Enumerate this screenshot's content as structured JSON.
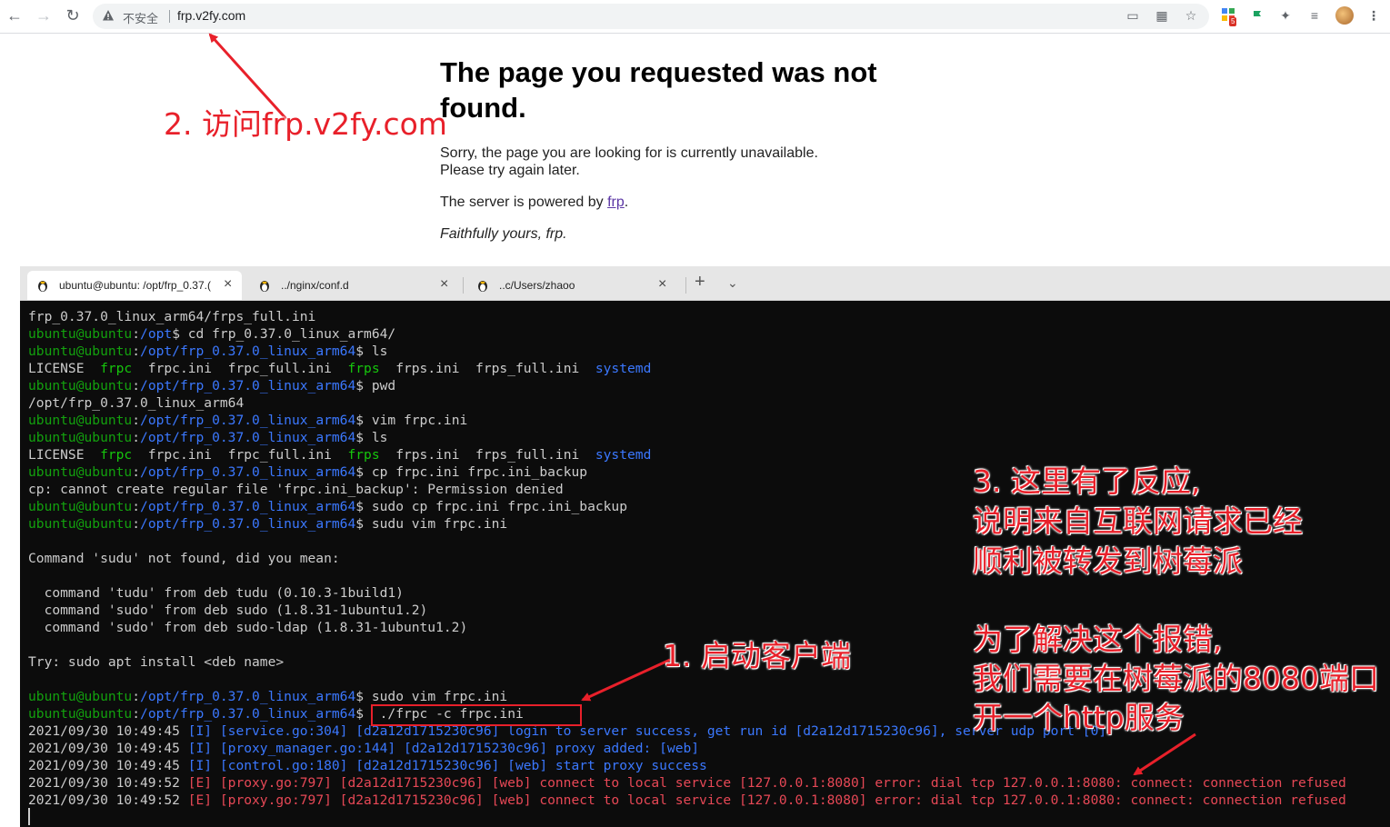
{
  "browser": {
    "security_label": "不安全",
    "url": "frp.v2fy.com",
    "extension_badge": "5"
  },
  "page": {
    "heading": "The page you requested was not found.",
    "sorry_line1": "Sorry, the page you are looking for is currently unavailable.",
    "sorry_line2": "Please try again later.",
    "powered_prefix": "The server is powered by ",
    "powered_link": "frp",
    "powered_suffix": ".",
    "signoff": "Faithfully yours, frp."
  },
  "terminal": {
    "tabs": [
      {
        "label": "ubuntu@ubuntu: /opt/frp_0.37.("
      },
      {
        "label": "../nginx/conf.d"
      },
      {
        "label": "..c/Users/zhaoo"
      }
    ],
    "lines": [
      {
        "segs": [
          {
            "t": "frp_0.37.0_linux_arm64/frps_full.ini",
            "c": ""
          }
        ]
      },
      {
        "segs": [
          {
            "t": "ubuntu@ubuntu",
            "c": "u"
          },
          {
            "t": ":",
            "c": ""
          },
          {
            "t": "/opt",
            "c": "pth"
          },
          {
            "t": "$ cd frp_0.37.0_linux_arm64/",
            "c": ""
          }
        ]
      },
      {
        "segs": [
          {
            "t": "ubuntu@ubuntu",
            "c": "u"
          },
          {
            "t": ":",
            "c": ""
          },
          {
            "t": "/opt/frp_0.37.0_linux_arm64",
            "c": "pth"
          },
          {
            "t": "$ ls",
            "c": ""
          }
        ]
      },
      {
        "segs": [
          {
            "t": "LICENSE  ",
            "c": ""
          },
          {
            "t": "frpc",
            "c": "g"
          },
          {
            "t": "  frpc.ini  frpc_full.ini  ",
            "c": ""
          },
          {
            "t": "frps",
            "c": "g"
          },
          {
            "t": "  frps.ini  frps_full.ini  ",
            "c": ""
          },
          {
            "t": "systemd",
            "c": "bl"
          }
        ]
      },
      {
        "segs": [
          {
            "t": "ubuntu@ubuntu",
            "c": "u"
          },
          {
            "t": ":",
            "c": ""
          },
          {
            "t": "/opt/frp_0.37.0_linux_arm64",
            "c": "pth"
          },
          {
            "t": "$ pwd",
            "c": ""
          }
        ]
      },
      {
        "segs": [
          {
            "t": "/opt/frp_0.37.0_linux_arm64",
            "c": ""
          }
        ]
      },
      {
        "segs": [
          {
            "t": "ubuntu@ubuntu",
            "c": "u"
          },
          {
            "t": ":",
            "c": ""
          },
          {
            "t": "/opt/frp_0.37.0_linux_arm64",
            "c": "pth"
          },
          {
            "t": "$ vim frpc.ini",
            "c": ""
          }
        ]
      },
      {
        "segs": [
          {
            "t": "ubuntu@ubuntu",
            "c": "u"
          },
          {
            "t": ":",
            "c": ""
          },
          {
            "t": "/opt/frp_0.37.0_linux_arm64",
            "c": "pth"
          },
          {
            "t": "$ ls",
            "c": ""
          }
        ]
      },
      {
        "segs": [
          {
            "t": "LICENSE  ",
            "c": ""
          },
          {
            "t": "frpc",
            "c": "g"
          },
          {
            "t": "  frpc.ini  frpc_full.ini  ",
            "c": ""
          },
          {
            "t": "frps",
            "c": "g"
          },
          {
            "t": "  frps.ini  frps_full.ini  ",
            "c": ""
          },
          {
            "t": "systemd",
            "c": "bl"
          }
        ]
      },
      {
        "segs": [
          {
            "t": "ubuntu@ubuntu",
            "c": "u"
          },
          {
            "t": ":",
            "c": ""
          },
          {
            "t": "/opt/frp_0.37.0_linux_arm64",
            "c": "pth"
          },
          {
            "t": "$ cp frpc.ini frpc.ini_backup",
            "c": ""
          }
        ]
      },
      {
        "segs": [
          {
            "t": "cp: cannot create regular file 'frpc.ini_backup': Permission denied",
            "c": ""
          }
        ]
      },
      {
        "segs": [
          {
            "t": "ubuntu@ubuntu",
            "c": "u"
          },
          {
            "t": ":",
            "c": ""
          },
          {
            "t": "/opt/frp_0.37.0_linux_arm64",
            "c": "pth"
          },
          {
            "t": "$ sudo cp frpc.ini frpc.ini_backup",
            "c": ""
          }
        ]
      },
      {
        "segs": [
          {
            "t": "ubuntu@ubuntu",
            "c": "u"
          },
          {
            "t": ":",
            "c": ""
          },
          {
            "t": "/opt/frp_0.37.0_linux_arm64",
            "c": "pth"
          },
          {
            "t": "$ sudu vim frpc.ini",
            "c": ""
          }
        ]
      },
      {
        "segs": [
          {
            "t": "",
            "c": ""
          }
        ]
      },
      {
        "segs": [
          {
            "t": "Command 'sudu' not found, did you mean:",
            "c": ""
          }
        ]
      },
      {
        "segs": [
          {
            "t": "",
            "c": ""
          }
        ]
      },
      {
        "segs": [
          {
            "t": "  command 'tudu' from deb tudu (0.10.3-1build1)",
            "c": ""
          }
        ]
      },
      {
        "segs": [
          {
            "t": "  command 'sudo' from deb sudo (1.8.31-1ubuntu1.2)",
            "c": ""
          }
        ]
      },
      {
        "segs": [
          {
            "t": "  command 'sudo' from deb sudo-ldap (1.8.31-1ubuntu1.2)",
            "c": ""
          }
        ]
      },
      {
        "segs": [
          {
            "t": "",
            "c": ""
          }
        ]
      },
      {
        "segs": [
          {
            "t": "Try: sudo apt install <deb name>",
            "c": ""
          }
        ]
      },
      {
        "segs": [
          {
            "t": "",
            "c": ""
          }
        ]
      },
      {
        "segs": [
          {
            "t": "ubuntu@ubuntu",
            "c": "u"
          },
          {
            "t": ":",
            "c": ""
          },
          {
            "t": "/opt/frp_0.37.0_linux_arm64",
            "c": "pth"
          },
          {
            "t": "$ sudo vim frpc.ini",
            "c": ""
          }
        ]
      },
      {
        "segs": [
          {
            "t": "ubuntu@ubuntu",
            "c": "u"
          },
          {
            "t": ":",
            "c": ""
          },
          {
            "t": "/opt/frp_0.37.0_linux_arm64",
            "c": "pth"
          },
          {
            "t": "$  ./frpc -c frpc.ini",
            "c": ""
          }
        ]
      },
      {
        "segs": [
          {
            "t": "2021/09/30 10:49:45 ",
            "c": ""
          },
          {
            "t": "[I] [service.go:304] [d2a12d1715230c96] login to server success, get run id [d2a12d1715230c96], server udp port [0]",
            "c": "bl"
          }
        ]
      },
      {
        "segs": [
          {
            "t": "2021/09/30 10:49:45 ",
            "c": ""
          },
          {
            "t": "[I] [proxy_manager.go:144] [d2a12d1715230c96] proxy added: [web]",
            "c": "bl"
          }
        ]
      },
      {
        "segs": [
          {
            "t": "2021/09/30 10:49:45 ",
            "c": ""
          },
          {
            "t": "[I] [control.go:180] [d2a12d1715230c96] [web] start proxy success",
            "c": "bl"
          }
        ]
      },
      {
        "segs": [
          {
            "t": "2021/09/30 10:49:52 ",
            "c": ""
          },
          {
            "t": "[E] [proxy.go:797] [d2a12d1715230c96] [web] connect to local service [127.0.0.1:8080] error: dial tcp 127.0.0.1:8080: connect: connection refused",
            "c": "r"
          }
        ]
      },
      {
        "segs": [
          {
            "t": "2021/09/30 10:49:52 ",
            "c": ""
          },
          {
            "t": "[E] [proxy.go:797] [d2a12d1715230c96] [web] connect to local service [127.0.0.1:8080] error: dial tcp 127.0.0.1:8080: connect: connection refused",
            "c": "r"
          }
        ]
      }
    ]
  },
  "annotations": {
    "step1": "1. 启动客户端",
    "step2": "2. 访问frp.v2fy.com",
    "step3_line1": "3. 这里有了反应,",
    "step3_line2": "说明来自互联网请求已经",
    "step3_line3": "顺利被转发到树莓派",
    "fix_line1": "为了解决这个报错,",
    "fix_line2": "我们需要在树莓派的8080端口",
    "fix_line3": "开一个http服务"
  },
  "colors": {
    "annotation_red": "#e8202a",
    "terminal_bg": "#0c0c0c",
    "prompt_green": "#13a10e",
    "path_blue": "#3b78ff",
    "error_red": "#e74856"
  }
}
